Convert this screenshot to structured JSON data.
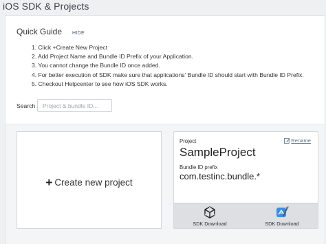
{
  "page": {
    "title": "iOS SDK & Projects"
  },
  "quick_guide": {
    "title": "Quick Guide",
    "hide_label": "HIDE",
    "steps": [
      "1. Click +Create New Project",
      "2. Add Project Name and Bundle ID Prefix of your Application.",
      "3. You cannot change the Bundle ID once added.",
      "4. For better execution of SDK make sure that applications' Bundle ID should start with Bundle ID Prefix.",
      "5. Checkout Helpcenter to see how iOS SDK works."
    ]
  },
  "search": {
    "label": "Search",
    "placeholder": "Project & bundle ID...",
    "value": ""
  },
  "create_card": {
    "icon": "plus-icon",
    "label": "Create new project"
  },
  "project_card": {
    "caption": "Project",
    "rename_label": "Rename",
    "rename_icon": "edit-icon",
    "name": "SampleProject",
    "bundle_caption": "Bundle ID prefix",
    "bundle_value": "com.testinc.bundle.*",
    "downloads": [
      {
        "icon": "unity-icon",
        "label": "SDK Download"
      },
      {
        "icon": "xcode-icon",
        "label": "SDK Download"
      }
    ]
  },
  "colors": {
    "page_bg": "#eef0f2",
    "panel_bg": "#ffffff",
    "section_bg": "#f4f5f6",
    "download_bar_bg": "#dddfe2",
    "link": "#58708a",
    "xcode_blue": "#3a8ee6"
  }
}
